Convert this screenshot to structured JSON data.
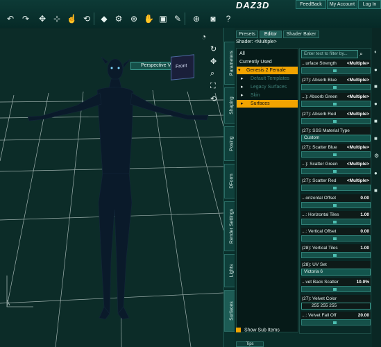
{
  "header": {
    "logo": "DAZ3D",
    "buttons": [
      "FeedBack",
      "My Account",
      "Log In"
    ]
  },
  "viewport": {
    "view_selector": "Perspective View",
    "nav_cube_label": "Front"
  },
  "side_tabs": [
    "Parameters",
    "Shaping",
    "Posing",
    "DForm",
    "Render Settings",
    "Lights",
    "Surfaces"
  ],
  "panel": {
    "tabs": [
      "Presets",
      "Editor",
      "Shader Baker"
    ],
    "active_tab": "Editor",
    "shader_line": "Shader: <Multiple>",
    "filter_placeholder": "Enter text to filter by...",
    "tree": [
      {
        "label": "All",
        "state": "normal"
      },
      {
        "label": "Currently Used",
        "state": "normal"
      },
      {
        "label": "Genesis 2 Female",
        "state": "selected"
      },
      {
        "label": "Default Templates",
        "state": "dim"
      },
      {
        "label": "Legacy Surfaces",
        "state": "dim"
      },
      {
        "label": "Skin",
        "state": "dim"
      },
      {
        "label": "Surfaces",
        "state": "selected"
      }
    ],
    "properties": [
      {
        "label": "...urface Strength",
        "value": "<Multiple>",
        "kind": "slider"
      },
      {
        "label": "(27): Absorb Blue",
        "value": "<Multiple>",
        "kind": "slider"
      },
      {
        "label": "...): Absorb Green",
        "value": "<Multiple>",
        "kind": "slider"
      },
      {
        "label": "(27): Absorb Red",
        "value": "<Multiple>",
        "kind": "slider"
      },
      {
        "label": "(27): SSS Material Type",
        "value": "Custom",
        "kind": "dropdown"
      },
      {
        "label": "(27): Scatter Blue",
        "value": "<Multiple>",
        "kind": "slider"
      },
      {
        "label": "...): Scatter Green",
        "value": "<Multiple>",
        "kind": "slider"
      },
      {
        "label": "(27): Scatter Red",
        "value": "<Multiple>",
        "kind": "slider"
      },
      {
        "label": "...orizontal Offset",
        "value": "0.00",
        "kind": "slider"
      },
      {
        "label": "...: Horizontal Tiles",
        "value": "1.00",
        "kind": "slider"
      },
      {
        "label": "...: Vertical Offset",
        "value": "0.00",
        "kind": "slider"
      },
      {
        "label": "(28): Vertical Tiles",
        "value": "1.00",
        "kind": "slider"
      },
      {
        "label": "(28): UV Set",
        "value": "Victoria 6",
        "kind": "dropdown"
      },
      {
        "label": "...vet Back Scatter",
        "value": "10.0%",
        "kind": "slider"
      },
      {
        "label": "(27): Velvet Color",
        "value": "255 255 255",
        "kind": "color"
      },
      {
        "label": "...: Velvet Fall Off",
        "value": "20.00",
        "kind": "slider"
      }
    ],
    "show_sub_items": "Show Sub Items",
    "tips_tab": "Tips"
  }
}
